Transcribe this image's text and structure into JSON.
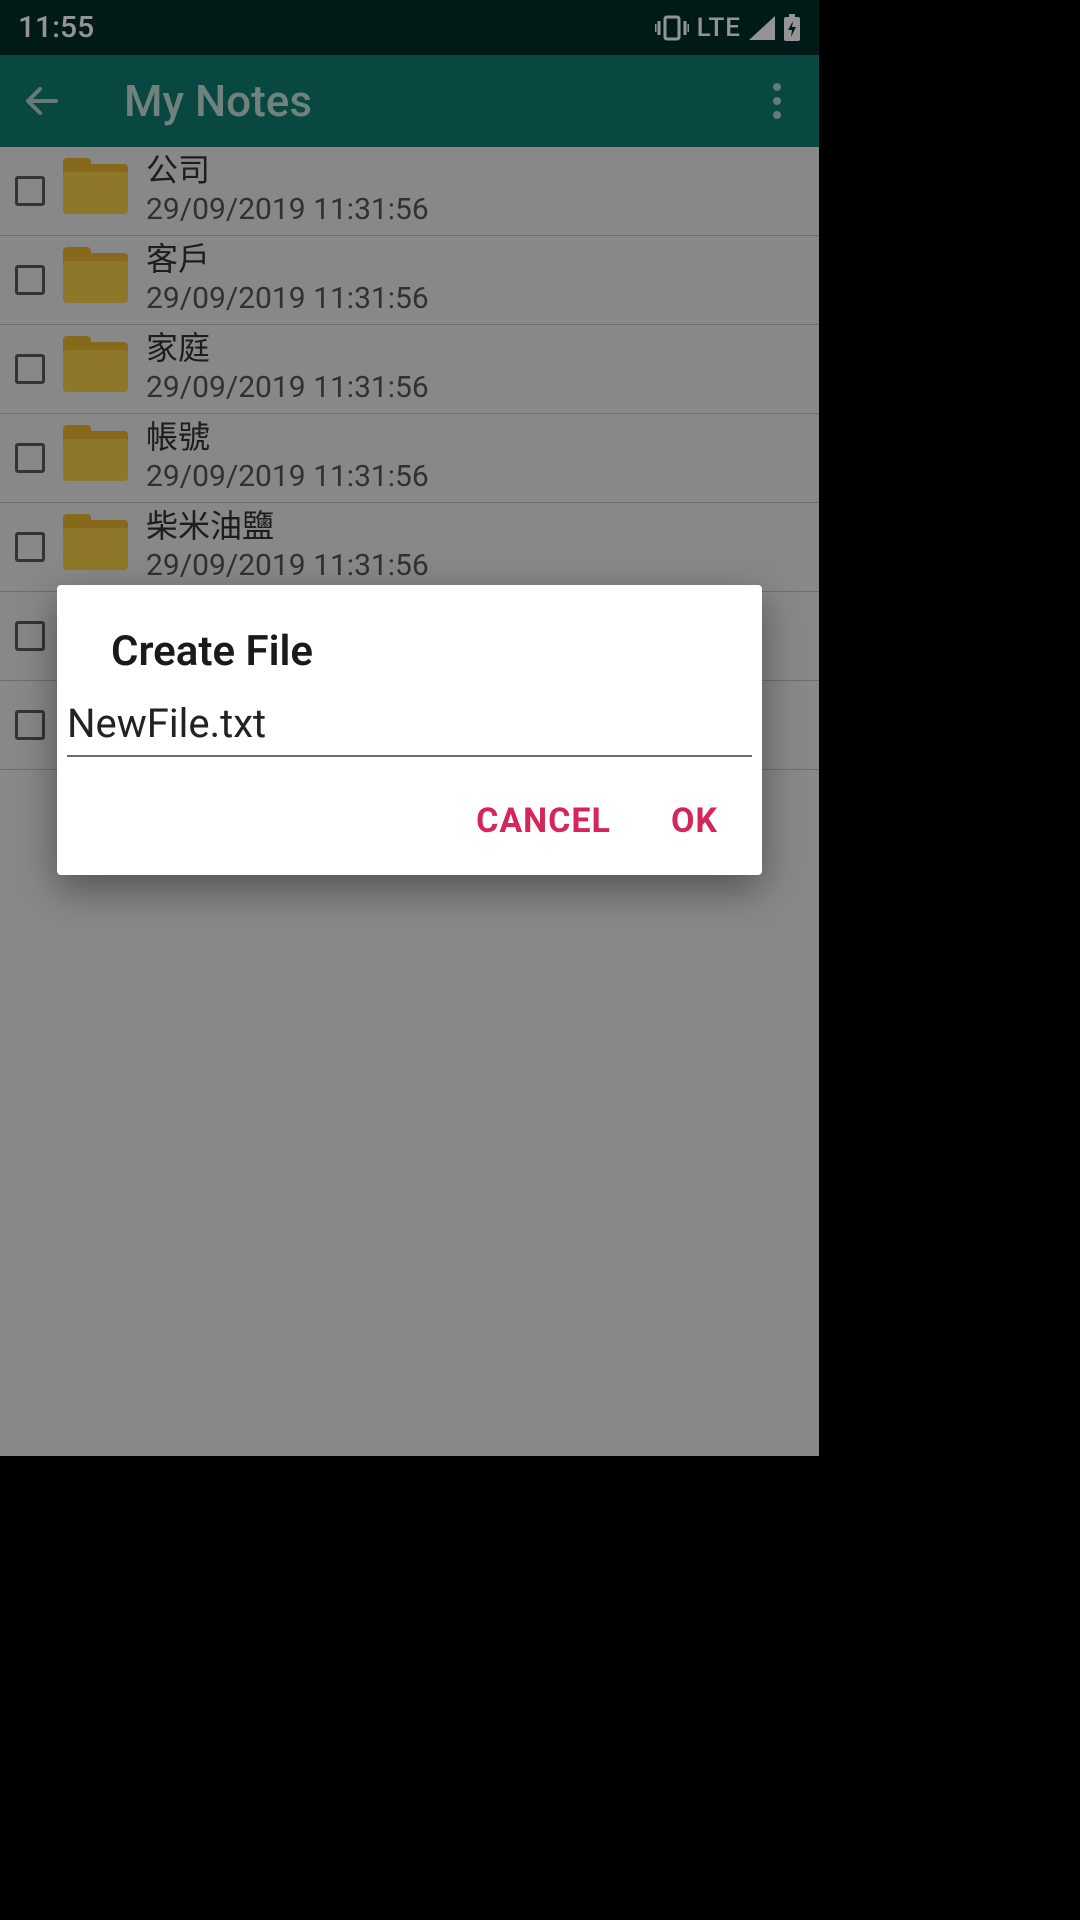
{
  "statusbar": {
    "time": "11:55",
    "lte": "LTE"
  },
  "appbar": {
    "title": "My Notes"
  },
  "folders": [
    {
      "name": "公司",
      "date": "29/09/2019 11:31:56"
    },
    {
      "name": "客戶",
      "date": "29/09/2019 11:31:56"
    },
    {
      "name": "家庭",
      "date": "29/09/2019 11:31:56"
    },
    {
      "name": "帳號",
      "date": "29/09/2019 11:31:56"
    },
    {
      "name": "柴米油鹽",
      "date": "29/09/2019 11:31:56"
    },
    {
      "name": "",
      "date": ""
    },
    {
      "name": "",
      "date": ""
    }
  ],
  "dialog": {
    "title": "Create File",
    "input_value": "NewFile.txt",
    "cancel": "CANCEL",
    "ok": "OK"
  }
}
